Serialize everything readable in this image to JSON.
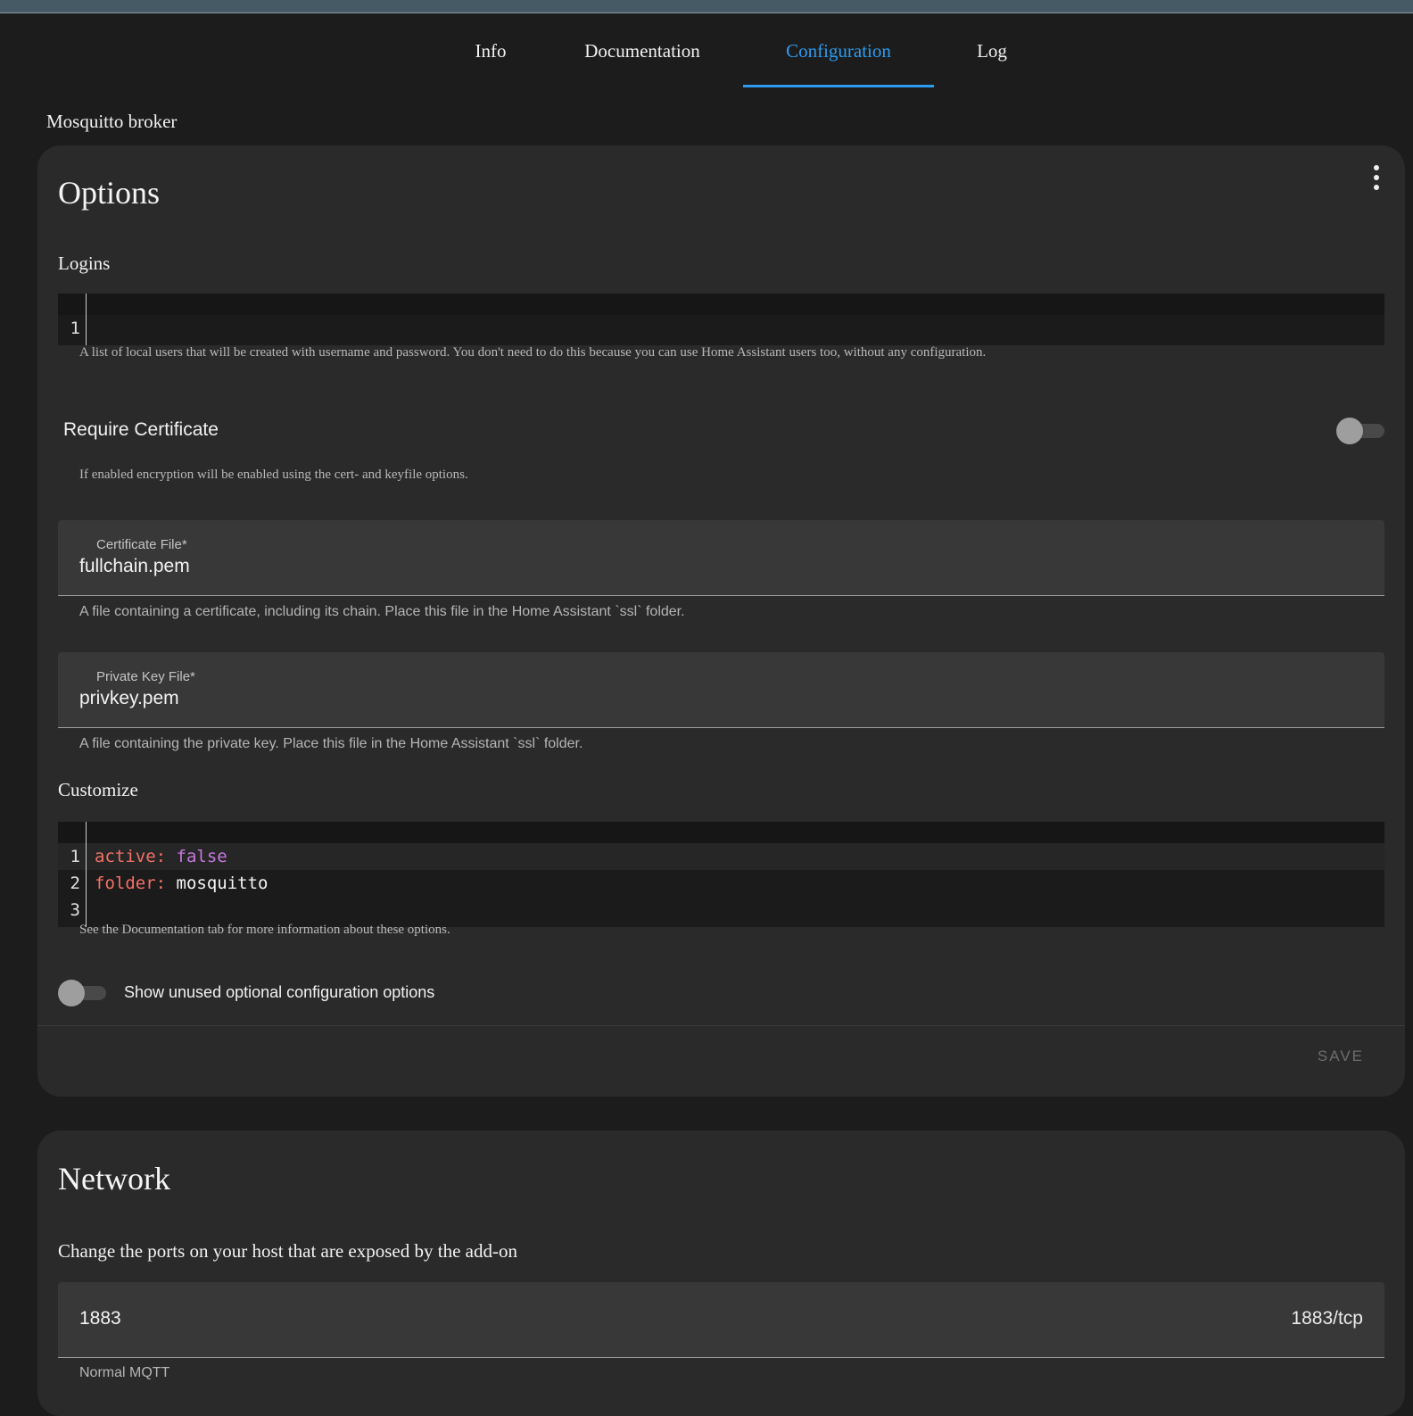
{
  "tabs": [
    {
      "label": "Info",
      "active": false
    },
    {
      "label": "Documentation",
      "active": false
    },
    {
      "label": "Configuration",
      "active": true
    },
    {
      "label": "Log",
      "active": false
    }
  ],
  "page_title": "Mosquitto broker",
  "options": {
    "title": "Options",
    "menu_icon": "dots-vertical-icon",
    "logins": {
      "label": "Logins",
      "lines": [
        {
          "n": "1",
          "text": ""
        }
      ],
      "helper": "A list of local users that will be created with username and password. You don't need to do this because you can use Home Assistant users too, without any configuration."
    },
    "require_certificate": {
      "label": "Require Certificate",
      "enabled": false,
      "helper": "If enabled encryption will be enabled using the cert- and keyfile options."
    },
    "certfile": {
      "label": "Certificate File*",
      "value": "fullchain.pem",
      "helper": "A file containing a certificate, including its chain. Place this file in the Home Assistant `ssl` folder."
    },
    "keyfile": {
      "label": "Private Key File*",
      "value": "privkey.pem",
      "helper": "A file containing the private key. Place this file in the Home Assistant `ssl` folder."
    },
    "customize": {
      "label": "Customize",
      "lines": [
        {
          "n": "1",
          "key": "active:",
          "value": "false"
        },
        {
          "n": "2",
          "key": "folder:",
          "value": "mosquitto"
        },
        {
          "n": "3",
          "key": "",
          "value": ""
        }
      ],
      "helper": "See the Documentation tab for more information about these options."
    },
    "show_unused": {
      "label": "Show unused optional configuration options",
      "enabled": false
    },
    "save_label": "SAVE"
  },
  "network": {
    "title": "Network",
    "description": "Change the ports on your host that are exposed by the add-on",
    "port": {
      "value": "1883",
      "suffix": "1883/tcp",
      "helper": "Normal MQTT"
    }
  },
  "colors": {
    "accent": "#2d9cf0",
    "background": "#1c1c1c",
    "card": "#2a2a2a",
    "yaml_key": "#f47067",
    "yaml_bool": "#c678dd"
  }
}
